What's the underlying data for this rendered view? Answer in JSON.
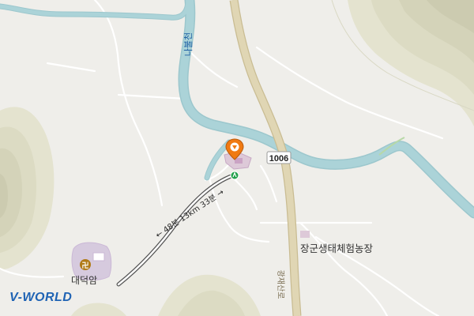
{
  "map": {
    "river_label": "나불천",
    "road_label": "광재산로",
    "route_number": "1006",
    "route_info": "← 48분 13km 33분 →",
    "places": {
      "farm": "장군생태체험농장",
      "temple": "대덕암"
    },
    "temple_symbol": "卍",
    "logo": "V-WORLD",
    "colors": {
      "river": "#abd3d8",
      "river_edge": "#9cc7cd",
      "road_major": "#d9ceaa",
      "road_minor": "#ffffff",
      "terrain": "#e0e0c9",
      "ground": "#efeeea",
      "marker": "#f07a12",
      "bus_stop": "#20a04a",
      "temple_area": "#d6cade"
    }
  }
}
